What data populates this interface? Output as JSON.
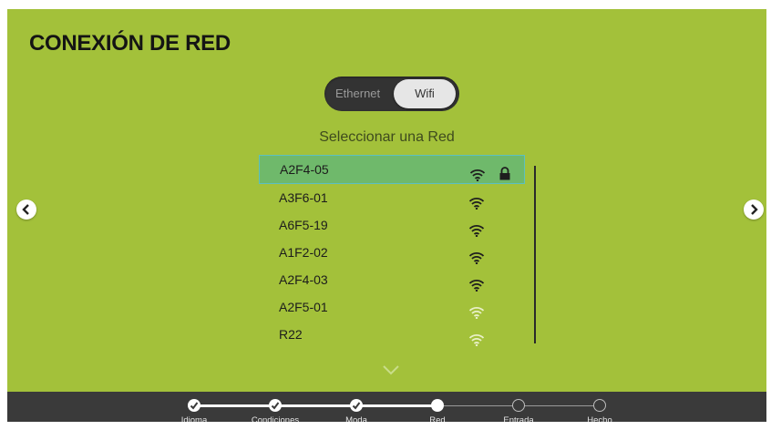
{
  "title": "CONEXIÓN DE RED",
  "toggle": {
    "ethernet": "Ethernet",
    "wifi": "Wifi",
    "selected": "Wifi"
  },
  "subtitle": "Seleccionar una Red",
  "networks": [
    {
      "name": "A2F4-05",
      "signal": "strong",
      "locked": true,
      "selected": true
    },
    {
      "name": "A3F6-01",
      "signal": "strong",
      "locked": false
    },
    {
      "name": "A6F5-19",
      "signal": "strong",
      "locked": false
    },
    {
      "name": "A1F2-02",
      "signal": "strong",
      "locked": false
    },
    {
      "name": "A2F4-03",
      "signal": "strong",
      "locked": false
    },
    {
      "name": "A2F5-01",
      "signal": "medium",
      "locked": false
    },
    {
      "name": "R22",
      "signal": "medium",
      "locked": false
    }
  ],
  "steps": [
    {
      "label": "Idioma",
      "state": "done"
    },
    {
      "label": "Condiciones",
      "state": "done"
    },
    {
      "label": "Moda",
      "state": "done"
    },
    {
      "label": "Red",
      "state": "current"
    },
    {
      "label": "Entrada",
      "state": "todo"
    },
    {
      "label": "Hecho",
      "state": "todo"
    }
  ],
  "icons": {
    "nav_left": "chevron-left-icon",
    "nav_right": "chevron-right-icon",
    "more": "chevron-down-icon",
    "wifi": "wifi-icon",
    "lock": "lock-icon",
    "check": "check-icon"
  },
  "colors": {
    "background": "#a3c13a",
    "selected_row": "#6fb96b",
    "bottom_bar": "#3a3a3a"
  }
}
